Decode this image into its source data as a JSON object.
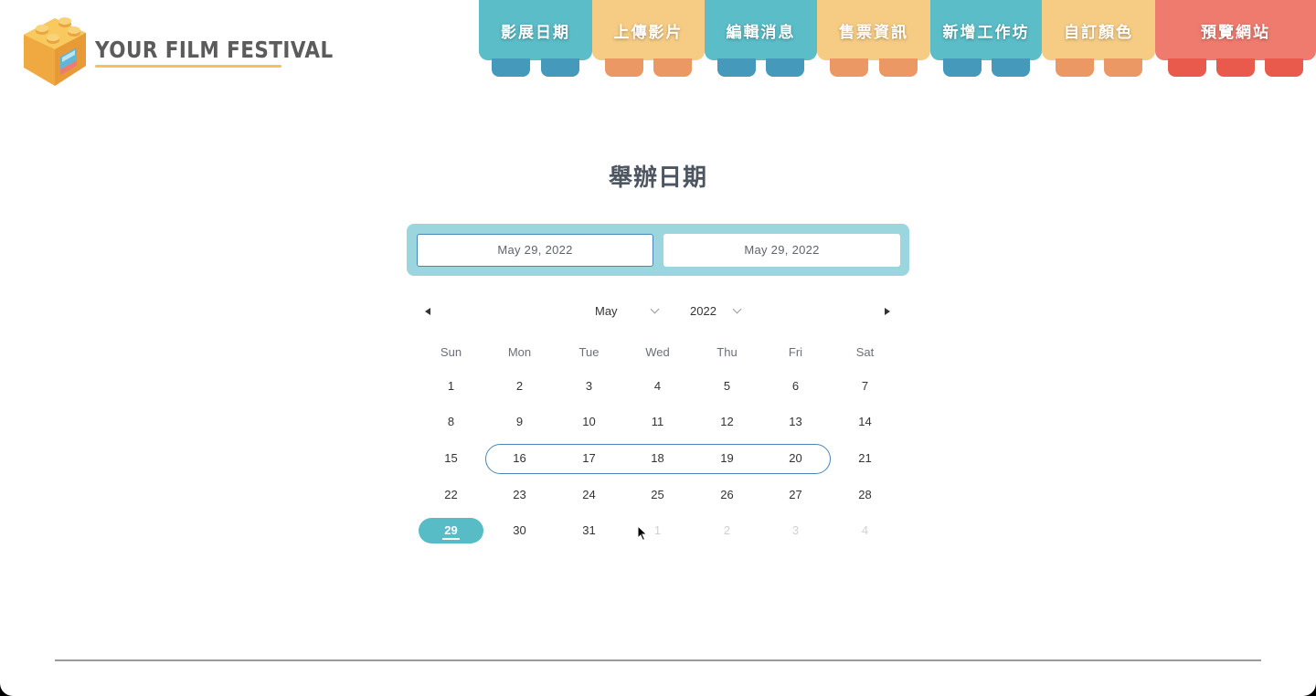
{
  "logo": {
    "text": "YOUR FILM FESTIVAL",
    "icon": "lego-block-icon",
    "colors": {
      "brick_top": "#f8c95f",
      "brick_side": "#f0a941",
      "window": "#5fb6d8"
    }
  },
  "nav": {
    "items": [
      {
        "label": "影展日期",
        "tab_color": "#5bbdc8",
        "stud_color": "#4599bb",
        "stud_count": 2
      },
      {
        "label": "上傳影片",
        "tab_color": "#f6cc84",
        "stud_color": "#ec9865",
        "stud_count": 2
      },
      {
        "label": "編輯消息",
        "tab_color": "#5bbdc8",
        "stud_color": "#4599bb",
        "stud_count": 2
      },
      {
        "label": "售票資訊",
        "tab_color": "#f6cc84",
        "stud_color": "#ec9865",
        "stud_count": 2
      },
      {
        "label": "新增工作坊",
        "tab_color": "#5bbdc8",
        "stud_color": "#4599bb",
        "stud_count": 2
      },
      {
        "label": "自訂顏色",
        "tab_color": "#f6cc84",
        "stud_color": "#ec9865",
        "stud_count": 2
      },
      {
        "label": "預覽網站",
        "tab_color": "#ef7b6e",
        "stud_color": "#ea5a4c",
        "stud_count": 3
      }
    ]
  },
  "heading": "舉辦日期",
  "range": {
    "start": "May 29, 2022",
    "end": "May 29, 2022"
  },
  "calendar": {
    "month": "May",
    "year": "2022",
    "weekdays": [
      "Sun",
      "Mon",
      "Tue",
      "Wed",
      "Thu",
      "Fri",
      "Sat"
    ],
    "weeks": [
      [
        "1",
        "2",
        "3",
        "4",
        "5",
        "6",
        "7"
      ],
      [
        "8",
        "9",
        "10",
        "11",
        "12",
        "13",
        "14"
      ],
      [
        "15",
        "16",
        "17",
        "18",
        "19",
        "20",
        "21"
      ],
      [
        "22",
        "23",
        "24",
        "25",
        "26",
        "27",
        "28"
      ],
      [
        "29",
        "30",
        "31",
        "1",
        "2",
        "3",
        "4"
      ]
    ],
    "today": "29",
    "accent_color": "#58bcc7",
    "outline_color": "#4a86b8"
  }
}
